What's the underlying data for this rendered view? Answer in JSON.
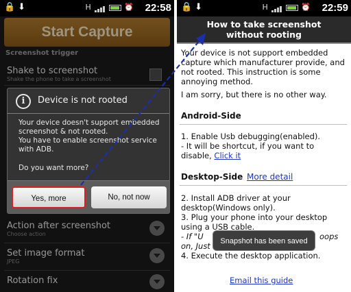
{
  "left": {
    "status": {
      "time": "22:58",
      "left_icons": "🔒 ⬇",
      "net": "H"
    },
    "start_capture": "Start Capture",
    "section_trigger": "Screenshot trigger",
    "shake_title": "Shake to screenshot",
    "shake_sub": "Shake the phone to take a screenshot",
    "action_title": "Action after screenshot",
    "action_sub": "Choose action",
    "format_title": "Set image format",
    "format_sub": "JPEG",
    "rotation_title": "Rotation fix",
    "dialog": {
      "title": "Device is not rooted",
      "body_line1": "Your device doesn't support embedded screenshot & not rooted.",
      "body_line2": "You have to enable screenshot service with ADB.",
      "ask": "Do you want more?",
      "yes": "Yes, more",
      "no": "No, not now"
    }
  },
  "right": {
    "status": {
      "time": "22:59",
      "net": "H"
    },
    "title_line1": "How to take screenshot",
    "title_line2": "without rooting",
    "intro": "Your device is not support embedded capture which manufacturer provide, and not rooted. This instruction is some annoying method.",
    "sorry": "I am sorry, but there is no other way.",
    "android_heading": "Android-Side",
    "android_step": "1. Enable Usb debugging(enabled).",
    "android_note": " - It will be shortcut, if you want to disable,",
    "click_it": "Click it",
    "desktop_heading": "Desktop-Side",
    "more_detail": "More detail",
    "desktop_step2": "2. Install ADB driver at your desktop(Windows only).",
    "desktop_step3": "3. Plug your phone into your desktop using a USB cable.",
    "desktop_note_a": " - If \"U",
    "desktop_note_b": "oops",
    "desktop_note_c": "on, Just skip it(Press back button).",
    "desktop_step4": "4. Execute the desktop application.",
    "email": "Email this guide",
    "toast": "Snapshot has been saved"
  },
  "colors": {
    "accent_button": "#8a5a18",
    "highlight_border": "#e01e1e",
    "link": "#1a35c9",
    "arrow": "#1b2fa8"
  },
  "icons": [
    "lock-icon",
    "download-icon",
    "signal-icon",
    "battery-icon",
    "alarm-icon",
    "info-icon",
    "chevron-down-icon",
    "checkbox-icon"
  ]
}
